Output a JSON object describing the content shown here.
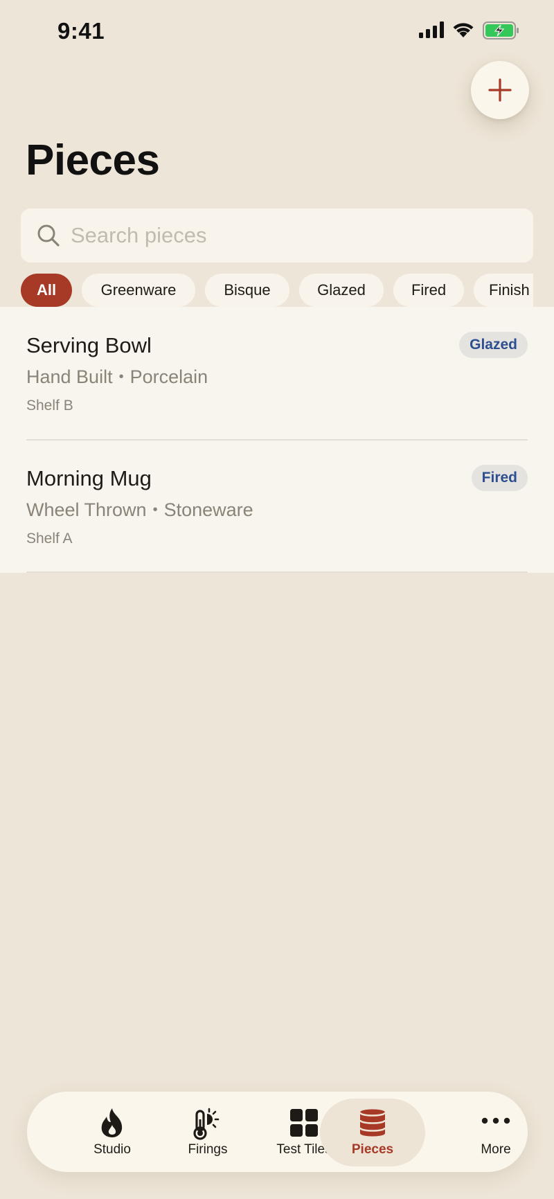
{
  "status_bar": {
    "time": "9:41"
  },
  "header": {
    "title": "Pieces",
    "add_button_icon": "plus-icon"
  },
  "search": {
    "placeholder": "Search pieces",
    "value": ""
  },
  "filters": [
    "All",
    "Greenware",
    "Bisque",
    "Glazed",
    "Fired",
    "Finish"
  ],
  "selected_filter": "All",
  "pieces": [
    {
      "name": "Serving Bowl",
      "method": "Hand Built",
      "clay": "Porcelain",
      "location": "Shelf B",
      "status": "Glazed"
    },
    {
      "name": "Morning Mug",
      "method": "Wheel Thrown",
      "clay": "Stoneware",
      "location": "Shelf A",
      "status": "Fired"
    }
  ],
  "meta_separator": "•",
  "tab_bar": {
    "items": [
      {
        "label": "Studio",
        "icon": "flame-icon"
      },
      {
        "label": "Firings",
        "icon": "thermometer-icon"
      },
      {
        "label": "Test Tiles",
        "icon": "grid-icon"
      },
      {
        "label": "Pieces",
        "icon": "cylinder-icon"
      },
      {
        "label": "More",
        "icon": "more-icon"
      }
    ],
    "active": "Pieces"
  },
  "colors": {
    "background": "#EDE5D7",
    "accent": "#A63A26",
    "badge_text": "#2D4E8F",
    "battery_fill": "#34C759"
  }
}
